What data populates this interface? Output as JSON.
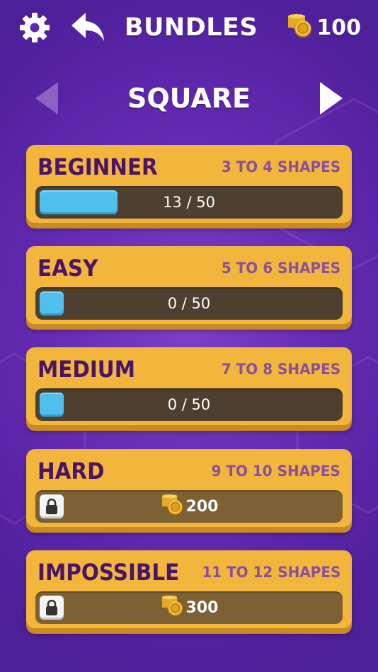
{
  "header": {
    "title": "BUNDLES",
    "coins": "100",
    "settings_icon": "gear-icon",
    "back_icon": "back-arrow-icon"
  },
  "category": {
    "name": "SQUARE",
    "prev_icon": "arrow-left-icon",
    "next_icon": "arrow-right-icon",
    "prev_enabled": false,
    "next_enabled": true
  },
  "bundles": [
    {
      "name": "BEGINNER",
      "range": "3 TO 4 SHAPES",
      "progress_text": "13 / 50",
      "completed": 13,
      "total": 50,
      "locked": false
    },
    {
      "name": "EASY",
      "range": "5 TO 6 SHAPES",
      "progress_text": "0 / 50",
      "completed": 0,
      "total": 50,
      "locked": false
    },
    {
      "name": "MEDIUM",
      "range": "7 TO 8 SHAPES",
      "progress_text": "0 / 50",
      "completed": 0,
      "total": 50,
      "locked": false
    },
    {
      "name": "HARD",
      "range": "9 TO 10 SHAPES",
      "cost": "200",
      "locked": true
    },
    {
      "name": "IMPOSSIBLE",
      "range": "11 TO 12 SHAPES",
      "cost": "300",
      "locked": true
    }
  ],
  "colors": {
    "background": "#5a25a8",
    "card": "#f2b63c",
    "card_title": "#4a1468",
    "card_range": "#8a4f9d",
    "progress_fill": "#4fc0ee",
    "progress_track": "#4e4031",
    "locked_track": "#7d6134"
  }
}
